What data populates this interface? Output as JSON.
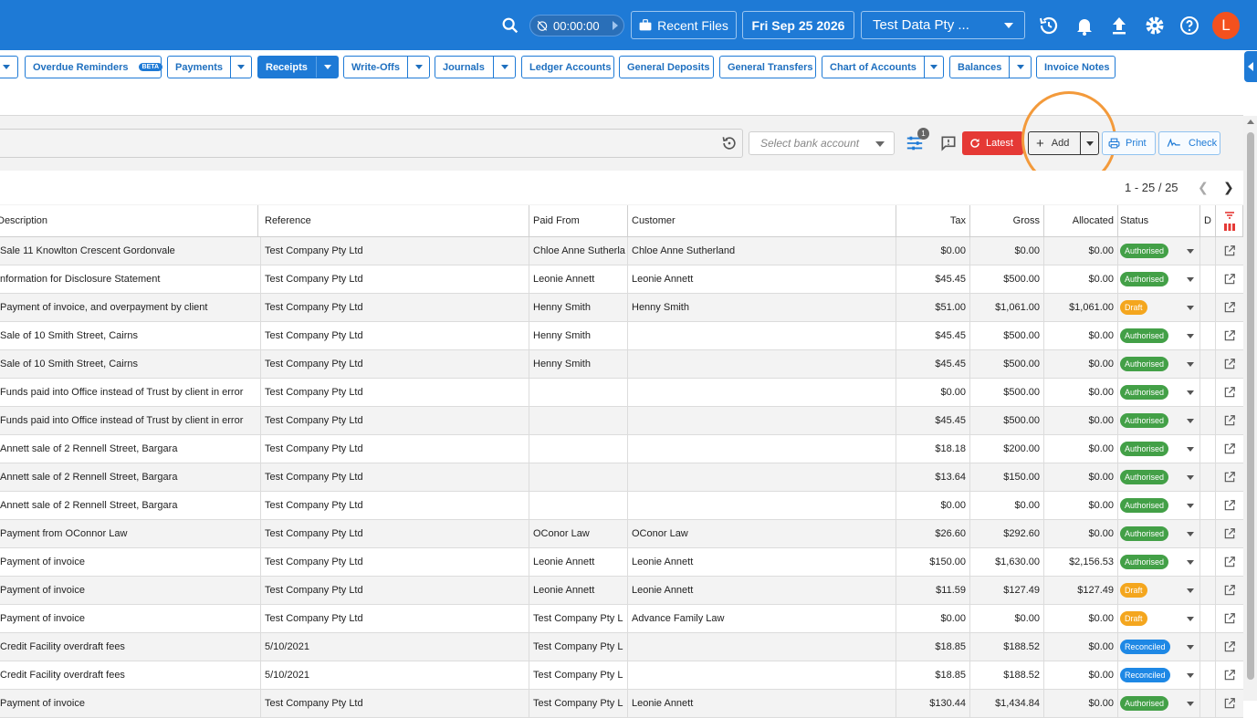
{
  "topbar": {
    "timer": "00:00:00",
    "recent_files": "Recent Files",
    "date": "Fri Sep 25 2026",
    "company": "Test Data Pty ...",
    "avatar_letter": "L"
  },
  "tabs": [
    {
      "label": "Overdue Reminders",
      "beta": "BETA"
    },
    {
      "label": "Payments"
    },
    {
      "label": "Receipts"
    },
    {
      "label": "Write-Offs"
    },
    {
      "label": "Journals"
    },
    {
      "label": "Ledger Accounts"
    },
    {
      "label": "General Deposits"
    },
    {
      "label": "General Transfers"
    },
    {
      "label": "Chart of Accounts"
    },
    {
      "label": "Balances"
    },
    {
      "label": "Invoice Notes"
    }
  ],
  "toolbar": {
    "bank_placeholder": "Select bank account",
    "filter_count": "1",
    "latest_label": "Latest",
    "add_label": "Add",
    "print_label": "Print",
    "check_label": "Check"
  },
  "pagination": {
    "info": "1 - 25 / 25"
  },
  "columns": {
    "description": "Description",
    "reference": "Reference",
    "paid_from": "Paid From",
    "customer": "Customer",
    "tax": "Tax",
    "gross": "Gross",
    "allocated": "Allocated",
    "status": "Status",
    "d": "D"
  },
  "rows": [
    {
      "description": "Sale 11 Knowlton Crescent Gordonvale",
      "reference": "Test Company Pty Ltd",
      "paid_from": "Chloe Anne Sutherla",
      "customer": "Chloe Anne Sutherland",
      "tax": "$0.00",
      "gross": "$0.00",
      "allocated": "$0.00",
      "status": "Authorised"
    },
    {
      "description": "nformation for Disclosure Statement",
      "reference": "Test Company Pty Ltd",
      "paid_from": "Leonie Annett",
      "customer": "Leonie Annett",
      "tax": "$45.45",
      "gross": "$500.00",
      "allocated": "$0.00",
      "status": "Authorised"
    },
    {
      "description": "Payment of invoice, and overpayment by client",
      "reference": "Test Company Pty Ltd",
      "paid_from": "Henny Smith",
      "customer": "Henny Smith",
      "tax": "$51.00",
      "gross": "$1,061.00",
      "allocated": "$1,061.00",
      "status": "Draft"
    },
    {
      "description": "Sale of 10 Smith Street, Cairns",
      "reference": "Test Company Pty Ltd",
      "paid_from": "Henny Smith",
      "customer": "",
      "tax": "$45.45",
      "gross": "$500.00",
      "allocated": "$0.00",
      "status": "Authorised"
    },
    {
      "description": "Sale of 10 Smith Street, Cairns",
      "reference": "Test Company Pty Ltd",
      "paid_from": "Henny Smith",
      "customer": "",
      "tax": "$45.45",
      "gross": "$500.00",
      "allocated": "$0.00",
      "status": "Authorised"
    },
    {
      "description": "Funds paid into Office instead of Trust by client in error",
      "reference": "Test Company Pty Ltd",
      "paid_from": "",
      "customer": "",
      "tax": "$0.00",
      "gross": "$500.00",
      "allocated": "$0.00",
      "status": "Authorised"
    },
    {
      "description": "Funds paid into Office instead of Trust by client in error",
      "reference": "Test Company Pty Ltd",
      "paid_from": "",
      "customer": "",
      "tax": "$45.45",
      "gross": "$500.00",
      "allocated": "$0.00",
      "status": "Authorised"
    },
    {
      "description": "Annett sale of 2 Rennell Street, Bargara",
      "reference": "Test Company Pty Ltd",
      "paid_from": "",
      "customer": "",
      "tax": "$18.18",
      "gross": "$200.00",
      "allocated": "$0.00",
      "status": "Authorised"
    },
    {
      "description": "Annett sale of 2 Rennell Street, Bargara",
      "reference": "Test Company Pty Ltd",
      "paid_from": "",
      "customer": "",
      "tax": "$13.64",
      "gross": "$150.00",
      "allocated": "$0.00",
      "status": "Authorised"
    },
    {
      "description": "Annett sale of 2 Rennell Street, Bargara",
      "reference": "Test Company Pty Ltd",
      "paid_from": "",
      "customer": "",
      "tax": "$0.00",
      "gross": "$0.00",
      "allocated": "$0.00",
      "status": "Authorised"
    },
    {
      "description": "Payment from OConnor Law",
      "reference": "Test Company Pty Ltd",
      "paid_from": "OConor Law",
      "customer": "OConor Law",
      "tax": "$26.60",
      "gross": "$292.60",
      "allocated": "$0.00",
      "status": "Authorised"
    },
    {
      "description": "Payment of invoice",
      "reference": "Test Company Pty Ltd",
      "paid_from": "Leonie Annett",
      "customer": "Leonie Annett",
      "tax": "$150.00",
      "gross": "$1,630.00",
      "allocated": "$2,156.53",
      "status": "Authorised"
    },
    {
      "description": "Payment of invoice",
      "reference": "Test Company Pty Ltd",
      "paid_from": "Leonie Annett",
      "customer": "Leonie Annett",
      "tax": "$11.59",
      "gross": "$127.49",
      "allocated": "$127.49",
      "status": "Draft"
    },
    {
      "description": "Payment of invoice",
      "reference": "Test Company Pty Ltd",
      "paid_from": "Test Company Pty L",
      "customer": "Advance Family Law",
      "tax": "$0.00",
      "gross": "$0.00",
      "allocated": "$0.00",
      "status": "Draft"
    },
    {
      "description": "Credit Facility overdraft fees",
      "reference": "5/10/2021",
      "paid_from": "Test Company Pty L",
      "customer": "",
      "tax": "$18.85",
      "gross": "$188.52",
      "allocated": "$0.00",
      "status": "Reconciled"
    },
    {
      "description": "Credit Facility overdraft fees",
      "reference": "5/10/2021",
      "paid_from": "Test Company Pty L",
      "customer": "",
      "tax": "$18.85",
      "gross": "$188.52",
      "allocated": "$0.00",
      "status": "Reconciled"
    },
    {
      "description": "Payment of invoice",
      "reference": "Test Company Pty Ltd",
      "paid_from": "Test Company Pty L",
      "customer": "Leonie Annett",
      "tax": "$130.44",
      "gross": "$1,434.84",
      "allocated": "$0.00",
      "status": "Authorised"
    }
  ],
  "colors": {
    "primary": "#1e7ad6",
    "authorised": "#43a047",
    "draft": "#f4a61e",
    "reconciled": "#1e88e5",
    "latest": "#e53935",
    "highlight": "#f39a3b"
  }
}
